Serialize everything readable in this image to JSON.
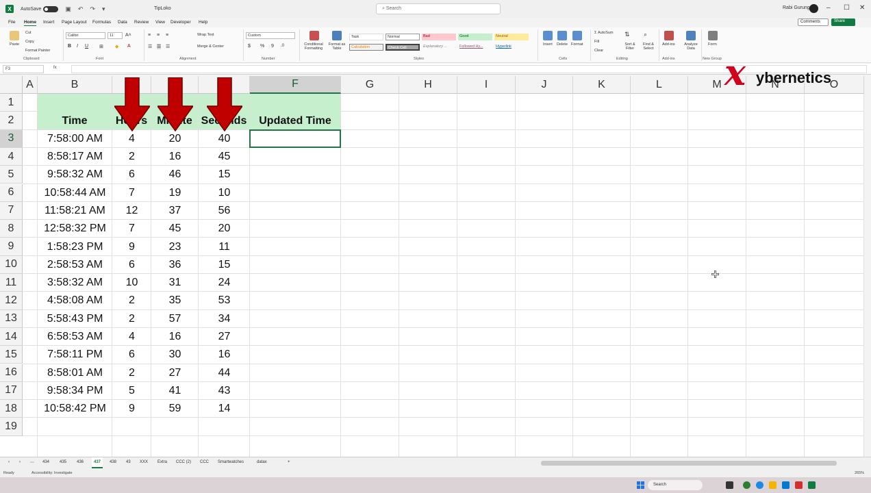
{
  "titlebar": {
    "autosave_label": "AutoSave",
    "autosave_state": "Off",
    "document_title": "TipLoko",
    "search_placeholder": "Search",
    "user_name": "Rabi Gurung"
  },
  "menu": {
    "tabs": [
      "File",
      "Home",
      "Insert",
      "Page Layout",
      "Formulas",
      "Data",
      "Review",
      "View",
      "Developer",
      "Help"
    ],
    "active_tab": "Home",
    "comments_label": "Comments",
    "share_label": "Share"
  },
  "ribbon": {
    "clipboard": {
      "paste": "Paste",
      "cut": "Cut",
      "copy": "Copy",
      "format_painter": "Format Painter",
      "group": "Clipboard"
    },
    "font": {
      "name": "Calibri",
      "size": "11",
      "group": "Font"
    },
    "alignment": {
      "wrap_text": "Wrap Text",
      "merge_center": "Merge & Center",
      "group": "Alignment"
    },
    "number": {
      "format": "Custom",
      "group": "Number"
    },
    "styles": {
      "conditional_formatting": "Conditional Formatting",
      "format_as_table": "Format as Table",
      "chips": [
        "Task",
        "Normal",
        "Bad",
        "Good",
        "Neutral",
        "Calculation",
        "Check Cell",
        "Explanatory ...",
        "Followed Hy...",
        "Hyperlink"
      ],
      "group": "Styles"
    },
    "cells": {
      "insert": "Insert",
      "delete": "Delete",
      "format": "Format",
      "group": "Cells"
    },
    "editing": {
      "autosum": "AutoSum",
      "fill": "Fill",
      "clear": "Clear",
      "sort_filter": "Sort & Filter",
      "find_select": "Find & Select",
      "group": "Editing"
    },
    "addins": {
      "addins": "Add-ins",
      "analyze": "Analyze Data",
      "group": "Add-ins"
    },
    "newgroup": {
      "form": "Form",
      "group": "New Group"
    }
  },
  "formula_bar": {
    "name_box": "F3",
    "fx": "fx",
    "content": ""
  },
  "sheet": {
    "columns": [
      "A",
      "B",
      "C",
      "D",
      "E",
      "F",
      "G",
      "H",
      "I",
      "J",
      "K",
      "L",
      "M",
      "N",
      "O"
    ],
    "selected_column": "F",
    "selected_row": "3",
    "rows": [
      "1",
      "2",
      "3",
      "4",
      "5",
      "6",
      "7",
      "8",
      "9",
      "10",
      "11",
      "12",
      "13",
      "14",
      "15",
      "16",
      "17",
      "18",
      "19"
    ],
    "headers": {
      "time": "Time",
      "hours": "Hours",
      "minute": "Minute",
      "seconds": "Seconds",
      "updated_time": "Updated Time"
    },
    "data": [
      {
        "time": "7:58:00 AM",
        "hours": "4",
        "minute": "20",
        "seconds": "40"
      },
      {
        "time": "8:58:17 AM",
        "hours": "2",
        "minute": "16",
        "seconds": "45"
      },
      {
        "time": "9:58:32 AM",
        "hours": "6",
        "minute": "46",
        "seconds": "15"
      },
      {
        "time": "10:58:44 AM",
        "hours": "7",
        "minute": "19",
        "seconds": "10"
      },
      {
        "time": "11:58:21 AM",
        "hours": "12",
        "minute": "37",
        "seconds": "56"
      },
      {
        "time": "12:58:32 PM",
        "hours": "7",
        "minute": "45",
        "seconds": "20"
      },
      {
        "time": "1:58:23 PM",
        "hours": "9",
        "minute": "23",
        "seconds": "11"
      },
      {
        "time": "2:58:53 AM",
        "hours": "6",
        "minute": "36",
        "seconds": "15"
      },
      {
        "time": "3:58:32 AM",
        "hours": "10",
        "minute": "31",
        "seconds": "24"
      },
      {
        "time": "4:58:08 AM",
        "hours": "2",
        "minute": "35",
        "seconds": "53"
      },
      {
        "time": "5:58:43 PM",
        "hours": "2",
        "minute": "57",
        "seconds": "34"
      },
      {
        "time": "6:58:53 AM",
        "hours": "4",
        "minute": "16",
        "seconds": "27"
      },
      {
        "time": "7:58:11 PM",
        "hours": "6",
        "minute": "30",
        "seconds": "16"
      },
      {
        "time": "8:58:01 AM",
        "hours": "2",
        "minute": "27",
        "seconds": "44"
      },
      {
        "time": "9:58:34 PM",
        "hours": "5",
        "minute": "41",
        "seconds": "43"
      },
      {
        "time": "10:58:42 PM",
        "hours": "9",
        "minute": "59",
        "seconds": "14"
      }
    ],
    "header_fill": "#c6efce",
    "arrow_color": "#c00000"
  },
  "watermark": {
    "x_letter": "x",
    "text": "ybernetics"
  },
  "sheet_tabs": {
    "tabs": [
      "434",
      "435",
      "436",
      "437",
      "438",
      "43",
      "XXX",
      "Extra",
      "CCC (2)",
      "CCC",
      "Smartwatches",
      "datax"
    ],
    "active": "437",
    "add": "+"
  },
  "statusbar": {
    "ready": "Ready",
    "accessibility": "Accessibility: Investigate",
    "zoom": "265%"
  },
  "taskbar": {
    "search": "Search"
  }
}
